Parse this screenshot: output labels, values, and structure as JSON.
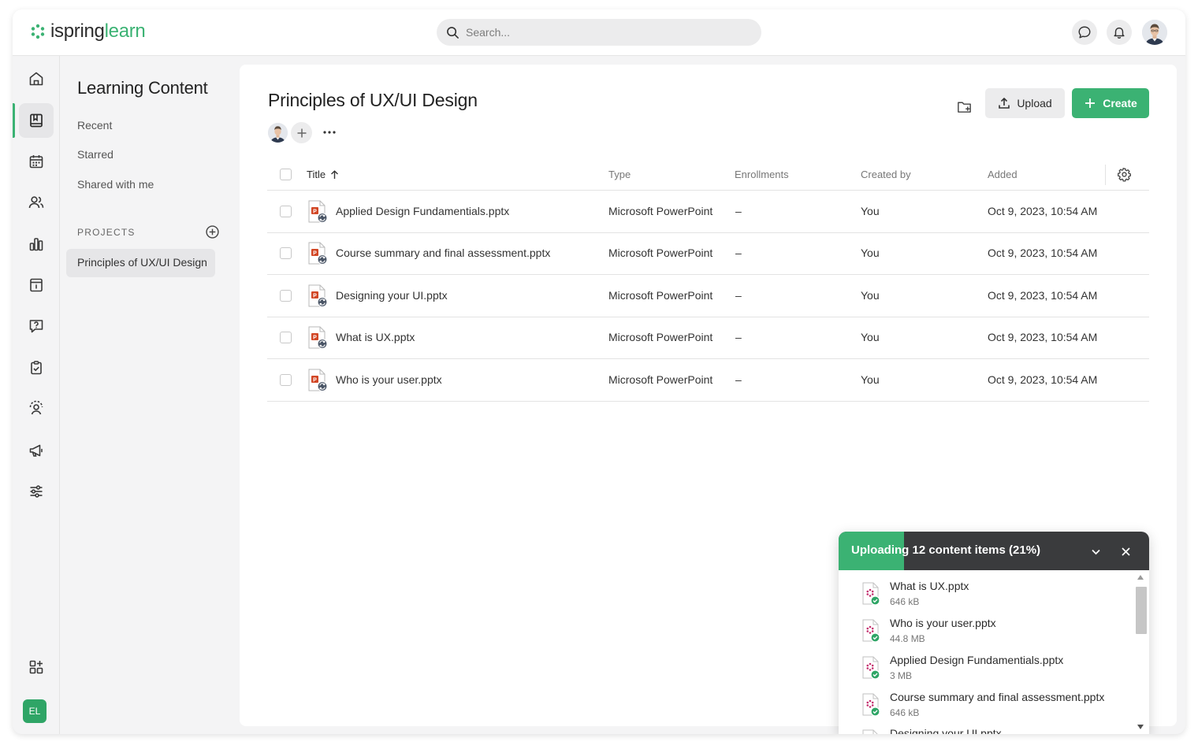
{
  "app": {
    "logo_brand": "ispring",
    "logo_product": "learn",
    "accent_color": "#3bb273"
  },
  "header": {
    "search_placeholder": "Search...",
    "chat_icon": "chat-bubble-icon",
    "notifications_icon": "bell-icon"
  },
  "rail": {
    "items": [
      "home-icon",
      "library-book-icon",
      "calendar-icon",
      "users-icon",
      "reports-chart-icon",
      "info-card-icon",
      "question-chat-icon",
      "clipboard-check-icon",
      "user-settings-icon",
      "megaphone-icon",
      "sliders-icon"
    ],
    "active": "library-book-icon",
    "apps_icon": "add-widget-icon",
    "user_initials": "EL"
  },
  "sidenav": {
    "title": "Learning Content",
    "links": [
      "Recent",
      "Starred",
      "Shared with me"
    ],
    "projects_label": "PROJECTS",
    "projects": [
      "Principles of UX/UI Design"
    ]
  },
  "main": {
    "title": "Principles of UX/UI Design",
    "upload_label": "Upload",
    "create_label": "Create",
    "columns": {
      "title": "Title",
      "type": "Type",
      "enrollments": "Enrollments",
      "created_by": "Created by",
      "added": "Added"
    },
    "rows": [
      {
        "title": "Applied Design Fundamentials.pptx",
        "type": "Microsoft PowerPoint",
        "enrollments": "–",
        "created_by": "You",
        "added": "Oct 9, 2023, 10:54 AM"
      },
      {
        "title": "Course summary and final assessment.pptx",
        "type": "Microsoft PowerPoint",
        "enrollments": "–",
        "created_by": "You",
        "added": "Oct 9, 2023, 10:54 AM"
      },
      {
        "title": "Designing your UI.pptx",
        "type": "Microsoft PowerPoint",
        "enrollments": "–",
        "created_by": "You",
        "added": "Oct 9, 2023, 10:54 AM"
      },
      {
        "title": "What is UX.pptx",
        "type": "Microsoft PowerPoint",
        "enrollments": "–",
        "created_by": "You",
        "added": "Oct 9, 2023, 10:54 AM"
      },
      {
        "title": "Who is your user.pptx",
        "type": "Microsoft PowerPoint",
        "enrollments": "–",
        "created_by": "You",
        "added": "Oct 9, 2023, 10:54 AM"
      }
    ]
  },
  "upload_panel": {
    "title": "Uploading 12 content items (21%)",
    "progress_percent": 21,
    "items": [
      {
        "name": "What is UX.pptx",
        "size": "646 kB"
      },
      {
        "name": "Who is your user.pptx",
        "size": "44.8 MB"
      },
      {
        "name": "Applied Design Fundamentials.pptx",
        "size": "3 MB"
      },
      {
        "name": "Course summary and final assessment.pptx",
        "size": "646 kB"
      },
      {
        "name": "Designing your UI.pptx",
        "size": ""
      }
    ]
  }
}
